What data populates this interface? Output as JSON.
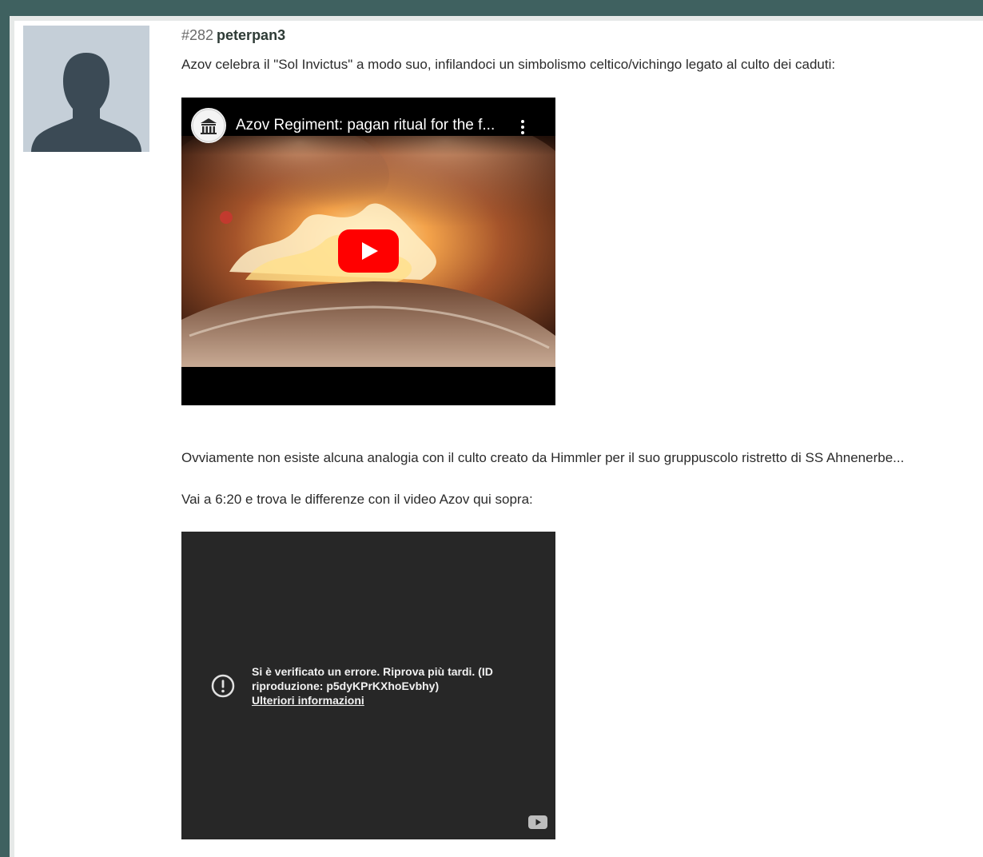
{
  "post": {
    "number": "#282",
    "author": "peterpan3",
    "paragraph_1": "Azov celebra il \"Sol Invictus\" a modo suo, infilandoci un simbolismo celtico/vichingo legato al culto dei caduti:",
    "paragraph_2": "Ovviamente non esiste alcuna analogia con il culto creato da Himmler per il suo gruppuscolo ristretto di SS Ahnenerbe...",
    "paragraph_3": "Vai a 6:20 e trova le differenze con il video Azov qui sopra:"
  },
  "video_1": {
    "title": "Azov Regiment: pagan ritual for the f...",
    "icons": {
      "channel": "channel-logo-icon",
      "menu": "more-vertical-icon",
      "play": "youtube-play-icon"
    },
    "colors": {
      "play_red": "#ff0000"
    }
  },
  "video_2": {
    "error_message": "Si è verificato un errore. Riprova più tardi. (ID riproduzione: p5dyKPrKXhoEvbhy)",
    "learn_more": "Ulteriori informazioni",
    "icons": {
      "error": "error-circle-icon",
      "logo": "youtube-logo-icon"
    }
  }
}
